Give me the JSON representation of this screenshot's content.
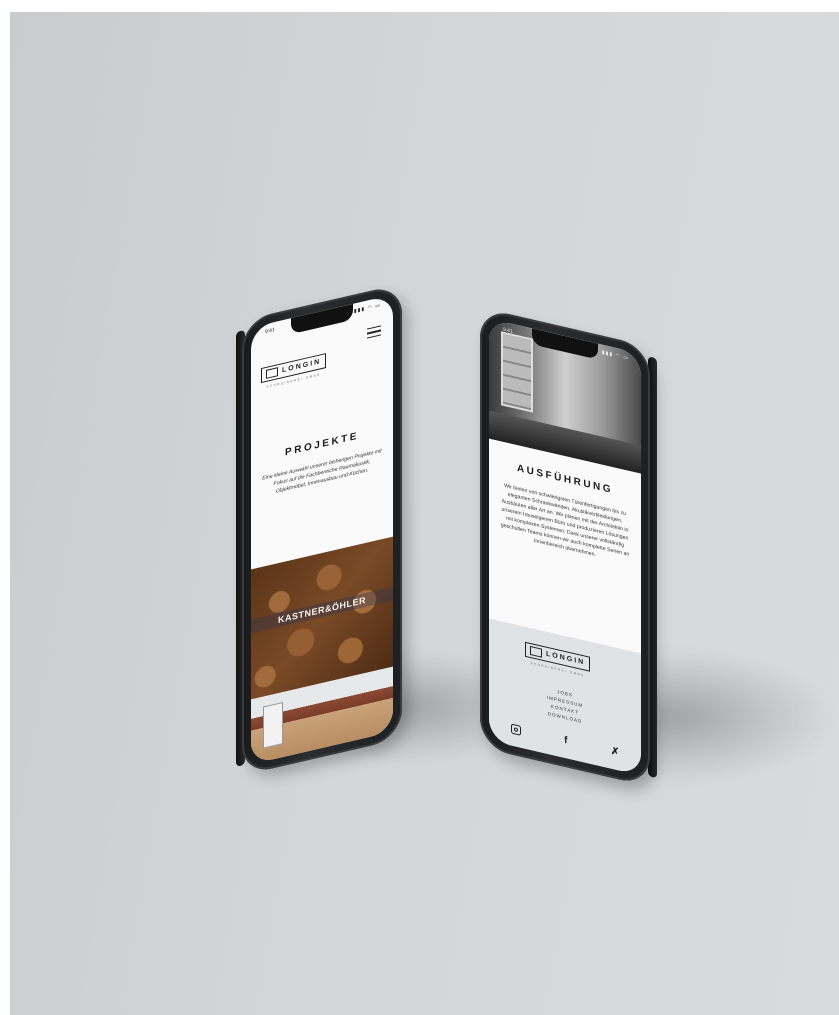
{
  "left_phone": {
    "status_time": "9:41",
    "status_icons": "▮▮▮ ◠ ▭",
    "logo_text": "LONGIN",
    "logo_sub": "SCHREINEREI GMBH",
    "heading": "PROJEKTE",
    "description": "Eine kleine Auswahl unserer bisherigen Projekte mit Fokus auf die Fachbereiche Raumakustik, Objektmöbel, Innenausbau und Küchen.",
    "project_label": "KASTNER&ÖHLER",
    "menu_icon": "hamburger-icon"
  },
  "right_phone": {
    "status_time": "9:41",
    "status_icons": "▮▮▮ ◠ ▭",
    "heading": "AUSFÜHRUNG",
    "description": "Wir bieten von schwierigsten Türenfertigungen bis zu eleganten Schrankwänden, Akustikverkleidungen, Ausbauten aller Art an. Wir planen mit der Architektin in unserem hauseigenen Büro und produzieren Lösungen mit komplexen Systemen. Dank unserer vollständig geschulten Teams können wir auch komplette Serien an Innenbereich übernehmen.",
    "logo_text": "LONGIN",
    "logo_sub": "SCHREINEREI GMBH",
    "footer_links": [
      "JOBS",
      "IMPRESSUM",
      "KONTAKT",
      "DOWNLOAD"
    ],
    "social_icons": [
      "instagram-icon",
      "facebook-icon",
      "xing-icon"
    ]
  },
  "colors": {
    "background": "#d3d6d8",
    "phone_body": "#1e1f21",
    "screen": "#fafafa",
    "footer_bg": "#dfe3e6",
    "wood": "#8a5a32"
  }
}
